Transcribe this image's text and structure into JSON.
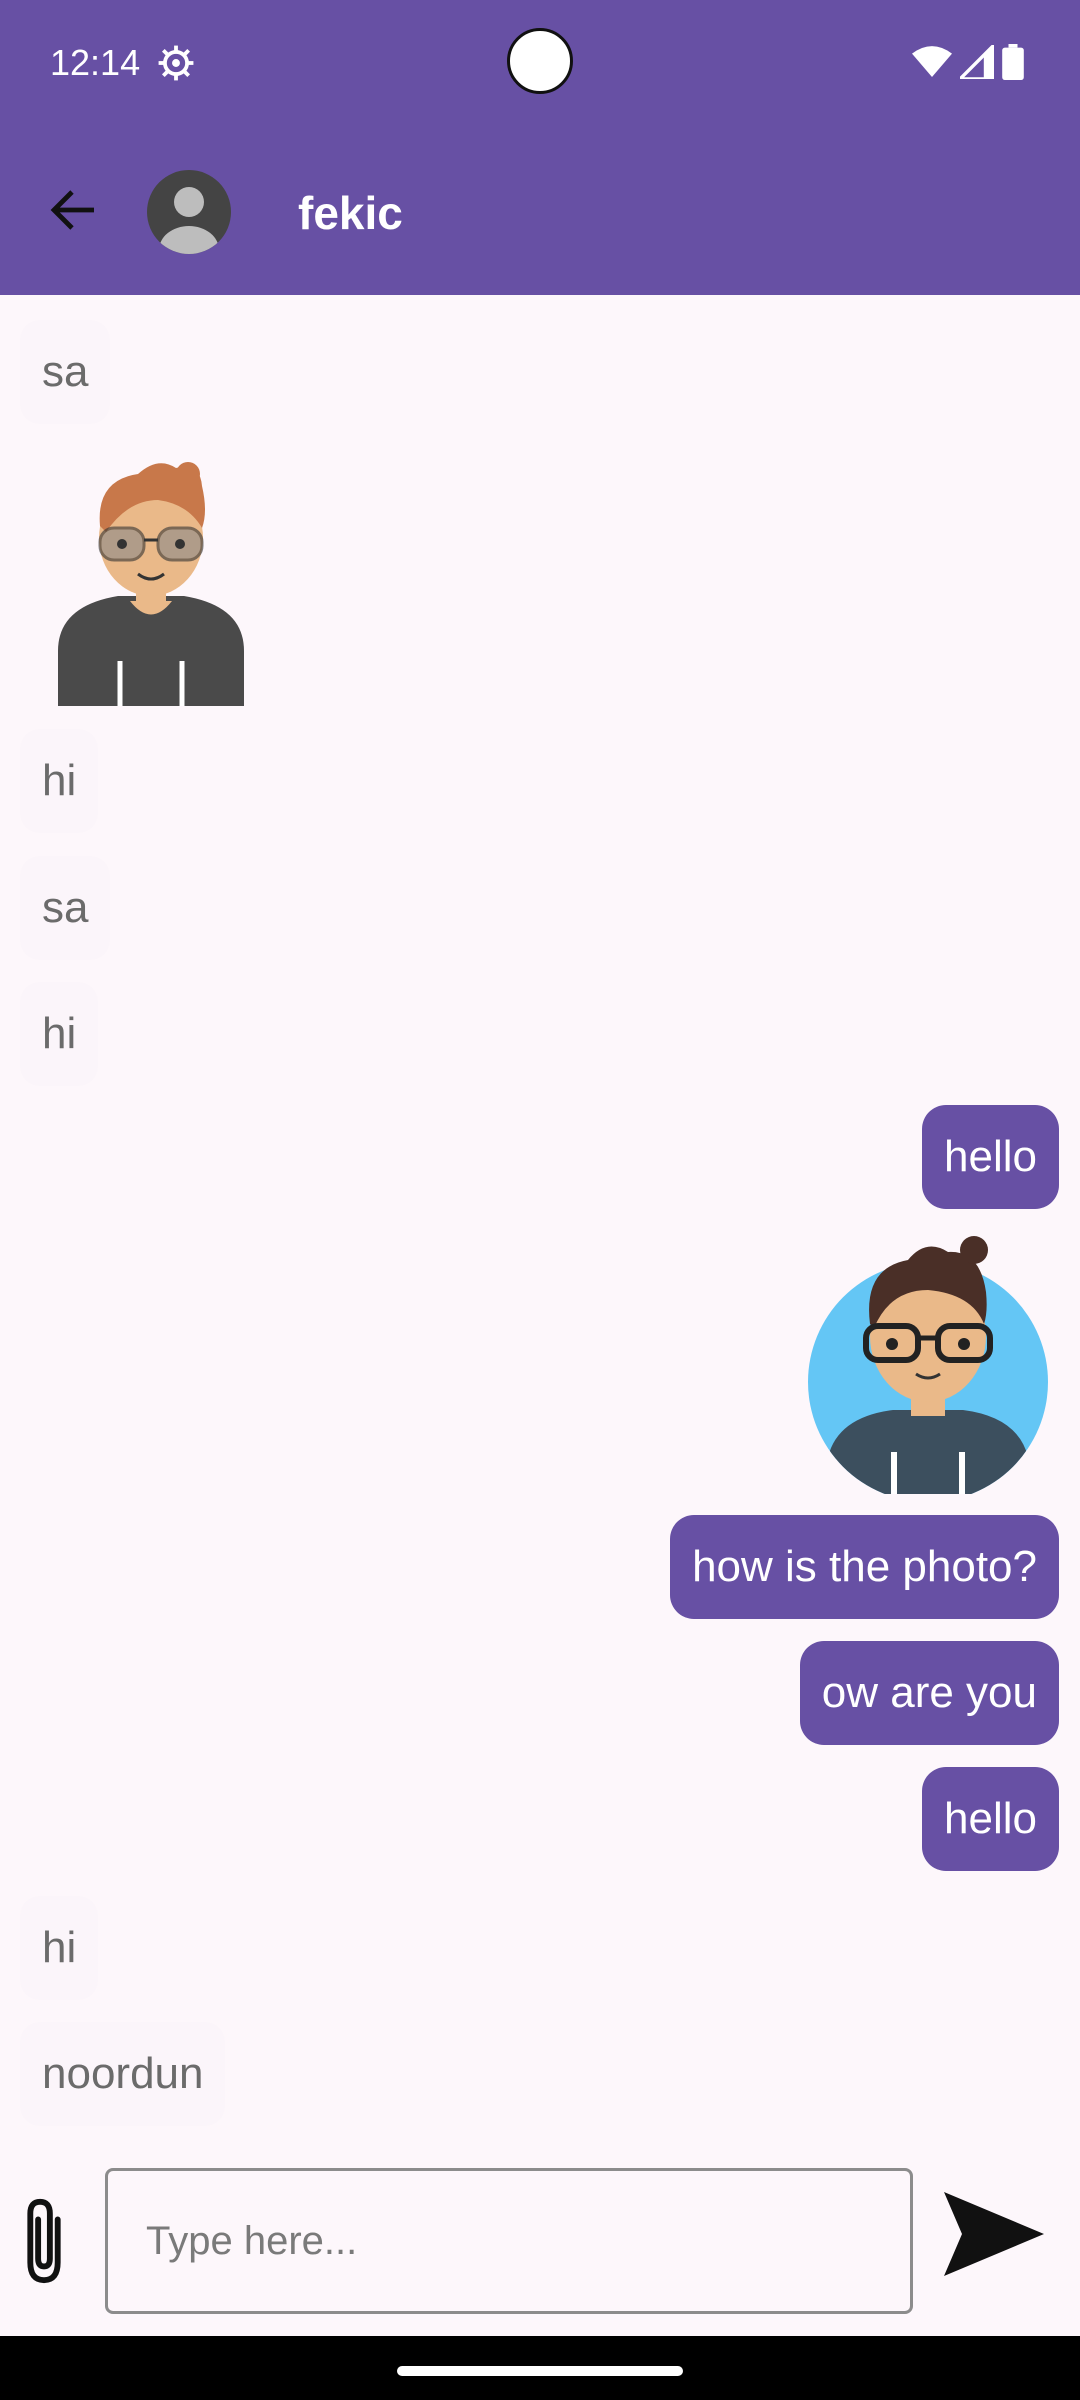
{
  "status_bar": {
    "time": "12:14"
  },
  "header": {
    "contact_name": "fekic"
  },
  "messages": [
    {
      "direction": "in",
      "text": "sa"
    },
    {
      "direction": "in",
      "image": "avatar-photo-glasses"
    },
    {
      "direction": "in",
      "text": "hi"
    },
    {
      "direction": "in",
      "text": "sa"
    },
    {
      "direction": "in",
      "text": "hi"
    },
    {
      "direction": "out",
      "text": "hello"
    },
    {
      "direction": "out",
      "image": "avatar-photo-blue"
    },
    {
      "direction": "out",
      "text": "how is the photo?"
    },
    {
      "direction": "out",
      "text": "ow are you"
    },
    {
      "direction": "out",
      "text": "hello"
    },
    {
      "direction": "in",
      "text": "hi"
    },
    {
      "direction": "in",
      "text": "noordun"
    }
  ],
  "composer": {
    "placeholder": "Type here...",
    "value": ""
  },
  "colors": {
    "primary": "#6750a4",
    "background": "#fdf7fb",
    "incoming_bubble": "#fbf5fa"
  }
}
